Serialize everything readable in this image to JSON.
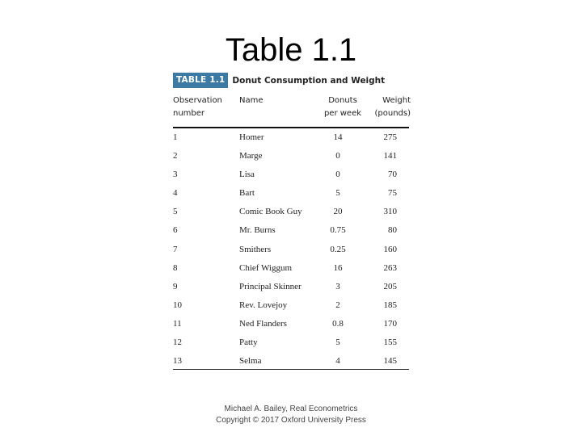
{
  "slide": {
    "title": "Table 1.1"
  },
  "table": {
    "badge": "TABLE 1.1",
    "caption": "Donut Consumption and Weight",
    "headers": {
      "observation": [
        "Observation",
        "number"
      ],
      "name": "Name",
      "donuts": [
        "Donuts",
        "per week"
      ],
      "weight": [
        "Weight",
        "(pounds)"
      ]
    },
    "rows": [
      {
        "obs": "1",
        "name": "Homer",
        "donuts": "14",
        "weight": "275"
      },
      {
        "obs": "2",
        "name": "Marge",
        "donuts": "0",
        "weight": "141"
      },
      {
        "obs": "3",
        "name": "Lisa",
        "donuts": "0",
        "weight": "70"
      },
      {
        "obs": "4",
        "name": "Bart",
        "donuts": "5",
        "weight": "75"
      },
      {
        "obs": "5",
        "name": "Comic Book Guy",
        "donuts": "20",
        "weight": "310"
      },
      {
        "obs": "6",
        "name": "Mr. Burns",
        "donuts": "0.75",
        "weight": "80"
      },
      {
        "obs": "7",
        "name": "Smithers",
        "donuts": "0.25",
        "weight": "160"
      },
      {
        "obs": "8",
        "name": "Chief Wiggum",
        "donuts": "16",
        "weight": "263"
      },
      {
        "obs": "9",
        "name": "Principal Skinner",
        "donuts": "3",
        "weight": "205"
      },
      {
        "obs": "10",
        "name": "Rev. Lovejoy",
        "donuts": "2",
        "weight": "185"
      },
      {
        "obs": "11",
        "name": "Ned Flanders",
        "donuts": "0.8",
        "weight": "170"
      },
      {
        "obs": "12",
        "name": "Patty",
        "donuts": "5",
        "weight": "155"
      },
      {
        "obs": "13",
        "name": "Selma",
        "donuts": "4",
        "weight": "145"
      }
    ]
  },
  "footer": {
    "line1": "Michael A. Bailey, Real Econometrics",
    "line2": "Copyright © 2017 Oxford University Press"
  },
  "colors": {
    "badge": "#3d7aa3"
  }
}
